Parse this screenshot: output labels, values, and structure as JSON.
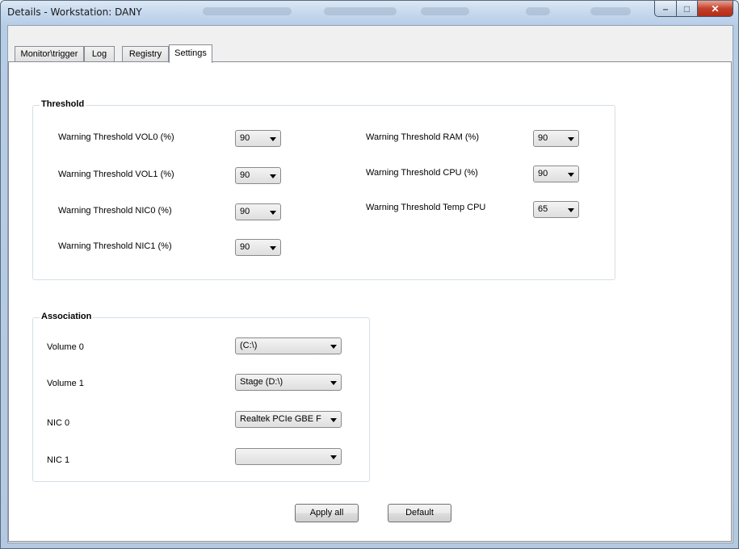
{
  "window": {
    "title": "Details - Workstation: DANY"
  },
  "tabs": [
    "Monitor\\trigger",
    "Log",
    "Registry",
    "Settings"
  ],
  "threshold": {
    "legend": "Threshold",
    "left": [
      {
        "label": "Warning Threshold VOL0 (%)",
        "value": "90"
      },
      {
        "label": "Warning Threshold VOL1 (%)",
        "value": "90"
      },
      {
        "label": "Warning Threshold NIC0 (%)",
        "value": "90"
      },
      {
        "label": "Warning Threshold NIC1 (%)",
        "value": "90"
      }
    ],
    "right": [
      {
        "label": "Warning Threshold RAM (%)",
        "value": "90"
      },
      {
        "label": "Warning Threshold CPU (%)",
        "value": "90"
      },
      {
        "label": "Warning Threshold Temp CPU",
        "value": "65"
      }
    ]
  },
  "association": {
    "legend": "Association",
    "rows": [
      {
        "label": "Volume 0",
        "value": "(C:\\)"
      },
      {
        "label": "Volume 1",
        "value": "Stage (D:\\)"
      },
      {
        "label": "NIC 0",
        "value": "Realtek PCIe GBE F"
      },
      {
        "label": "NIC 1",
        "value": ""
      }
    ]
  },
  "buttons": {
    "apply_all": "Apply all",
    "default": "Default"
  }
}
